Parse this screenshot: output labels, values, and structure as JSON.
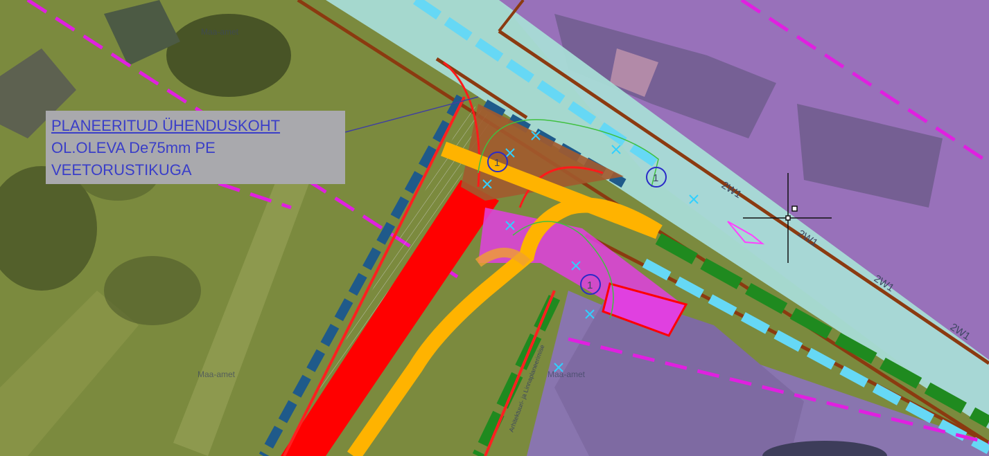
{
  "callout": {
    "line1": "PLANEERITUD ÜHENDUSKOHT",
    "line2": "OL.OLEVA De75mm PE",
    "line3": "VEETORUSTIKUGA"
  },
  "pipe_labels": [
    "2W1",
    "2W1",
    "2W1",
    "2W1"
  ],
  "marker_labels": [
    "1",
    "1",
    "1"
  ],
  "watermark": [
    "Maa-amet",
    "Maa-amet",
    "Maa-amet"
  ],
  "vertical_label": "Arhitektuuri- ja Linnaplaneerimise",
  "colors": {
    "grass": "#7b8a3e",
    "parcel_purple": "#9a6fc4",
    "road": "#a8dcd6",
    "road_edge": "#8b3a10",
    "planned_road": "#ff0000",
    "water_pipe": "#ffb300",
    "magenta_zone": "#e040e0",
    "green_strip": "#1f8a1f",
    "cyan_dash": "#66d8f5",
    "boundary_dash": "#e020e0",
    "callout_bg": "#a9a9ad",
    "callout_text": "#3a3ec8"
  }
}
